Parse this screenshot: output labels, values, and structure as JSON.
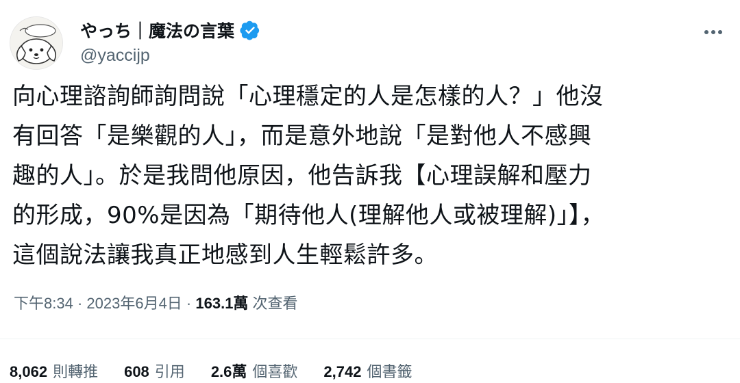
{
  "author": {
    "display_name": "やっち｜魔法の言葉",
    "handle": "@yaccijp",
    "verified": true,
    "verified_color": "#1d9bf0"
  },
  "tweet": {
    "lines": [
      "向心理諮詢師詢問說「心理穩定的人是怎樣的人？」他沒",
      "有回答「是樂觀的人」，而是意外地說「是對他人不感興",
      "趣的人」。於是我問他原因，他告訴我【心理誤解和壓力",
      "的形成，90%是因為「期待他人(理解他人或被理解)」】，",
      "這個說法讓我真正地感到人生輕鬆許多。"
    ]
  },
  "meta": {
    "time": "下午8:34",
    "separator1": " · ",
    "date": "2023年6月4日",
    "separator2": " · ",
    "views_count": "163.1萬",
    "views_label": " 次查看"
  },
  "stats": [
    {
      "value": "8,062",
      "label": "則轉推"
    },
    {
      "value": "608",
      "label": "引用"
    },
    {
      "value": "2.6萬",
      "label": "個喜歡"
    },
    {
      "value": "2,742",
      "label": "個書籤"
    }
  ],
  "icons": {
    "avatar": "avatar-dog-illustration",
    "verified": "verified-badge-icon",
    "more": "more-options-icon"
  }
}
